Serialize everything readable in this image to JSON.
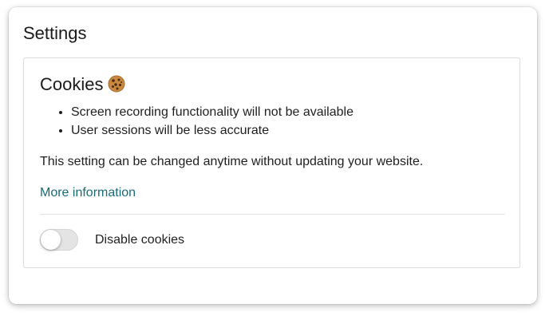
{
  "settings": {
    "title": "Settings"
  },
  "cookies_card": {
    "title": "Cookies",
    "title_icon": "cookie-icon",
    "bullets": [
      "Screen recording functionality will not be available",
      "User sessions will be less accurate"
    ],
    "note": "This setting can be changed anytime without updating your website.",
    "more_info_link": "More information",
    "toggle": {
      "label": "Disable cookies",
      "checked": false
    }
  },
  "colors": {
    "link": "#1a6b7a",
    "toggle_track_off": "#e4e4e4",
    "card_border": "#dcdcdc"
  }
}
